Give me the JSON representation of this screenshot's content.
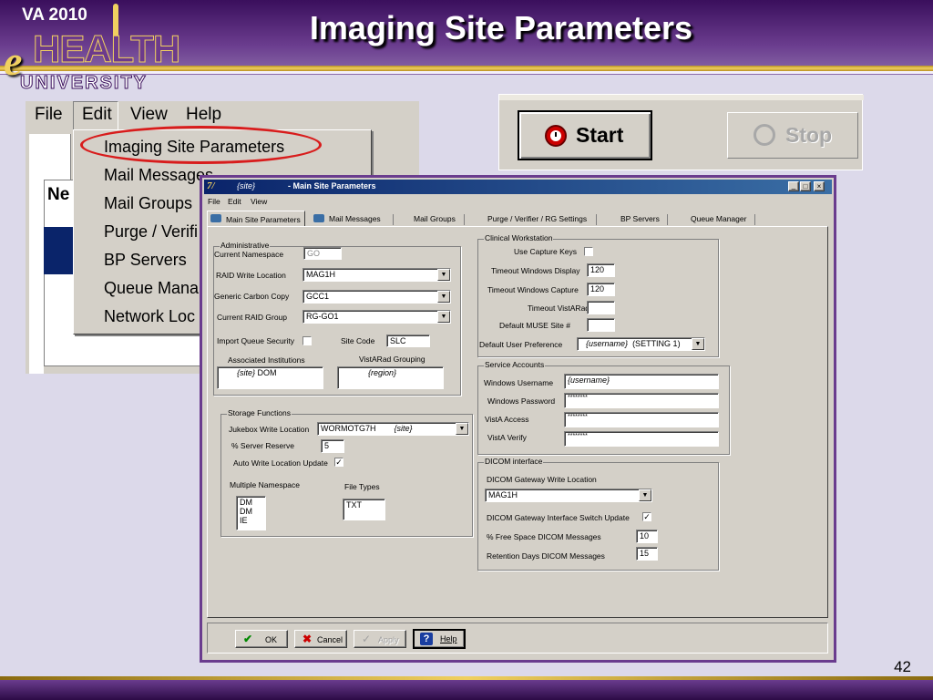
{
  "slide": {
    "title": "Imaging Site Parameters",
    "page_number": "42"
  },
  "logo": {
    "year_text": "VA 2010",
    "letter_e": "e",
    "health_text": "HEALTH",
    "university_text": "UNIVERSITY"
  },
  "menu_screenshot": {
    "menubar": [
      "File",
      "Edit",
      "View",
      "Help"
    ],
    "edit_menu_items": [
      "Imaging Site Parameters",
      "Mail Messages",
      "Mail Groups",
      "Purge / Verifi",
      "BP Servers",
      "Queue Mana",
      "Network Loc"
    ],
    "highlighted_item": "Imaging Site Parameters",
    "partial_list_text": "Ne"
  },
  "toolbar_screenshot": {
    "start_label": "Start",
    "stop_label": "Stop"
  },
  "dialog": {
    "title_site": "{site}",
    "title_text": "- Main Site Parameters",
    "menu": [
      "File",
      "Edit",
      "View"
    ],
    "tabs": [
      "Main Site Parameters",
      "Mail Messages",
      "Mail Groups",
      "Purge / Verifier / RG Settings",
      "BP Servers",
      "Queue Manager"
    ],
    "administrative": {
      "group_label": "Administrative",
      "current_namespace_label": "Current Namespace",
      "current_namespace_value": "GO",
      "raid_write_location_label": "RAID Write Location",
      "raid_write_location_value": "MAG1H",
      "generic_carbon_copy_label": "Generic Carbon Copy",
      "generic_carbon_copy_value": "GCC1",
      "current_raid_group_label": "Current  RAID Group",
      "current_raid_group_value": "RG-GO1",
      "import_queue_security_label": "Import Queue Security",
      "import_queue_security_checked": false,
      "site_code_label": "Site Code",
      "site_code_value": "SLC",
      "associated_institutions_label": "Associated Institutions",
      "associated_institutions_value_site": "{site}",
      "associated_institutions_value_code": "DOM",
      "vistarad_grouping_label": "VistARad Grouping",
      "vistarad_grouping_value": "{region}"
    },
    "storage": {
      "group_label": "Storage Functions",
      "jukebox_write_location_label": "Jukebox Write Location",
      "jukebox_write_location_value": "WORMOTG7H",
      "jukebox_write_location_site": "{site}",
      "server_reserve_label": "% Server Reserve",
      "server_reserve_value": "5",
      "auto_write_location_update_label": "Auto Write Location Update",
      "auto_write_location_update_checked": true,
      "multiple_namespace_label": "Multiple Namespace",
      "multiple_namespace_values": [
        "DM",
        "DM",
        "IE"
      ],
      "file_types_label": "File Types",
      "file_types_value": "TXT"
    },
    "clinical": {
      "group_label": "Clinical Workstation",
      "use_capture_keys_label": "Use Capture Keys",
      "use_capture_keys_checked": false,
      "timeout_windows_display_label": "Timeout Windows Display",
      "timeout_windows_display_value": "120",
      "timeout_windows_capture_label": "Timeout Windows Capture",
      "timeout_windows_capture_value": "120",
      "timeout_vistarad_label": "Timeout VistARad",
      "timeout_vistarad_value": "",
      "default_muse_site_label": "Default MUSE Site #",
      "default_muse_site_value": "",
      "default_user_preference_label": "Default User Preference",
      "default_user_preference_user": "{username}",
      "default_user_preference_setting": "(SETTING 1)"
    },
    "service": {
      "group_label": "Service Accounts",
      "windows_username_label": "Windows Username",
      "windows_username_value": "{username}",
      "windows_password_label": "Windows Password",
      "windows_password_value": "********",
      "vista_access_label": "VistA Access",
      "vista_access_value": "********",
      "vista_verify_label": "VistA Verify",
      "vista_verify_value": "********"
    },
    "dicom": {
      "group_label": "DICOM interface",
      "gateway_write_location_label": "DICOM Gateway Write Location",
      "gateway_write_location_value": "MAG1H",
      "interface_switch_update_label": "DICOM Gateway  Interface Switch Update",
      "interface_switch_update_checked": true,
      "free_space_label": "% Free Space DICOM Messages",
      "free_space_value": "10",
      "retention_days_label": "Retention Days DICOM Messages",
      "retention_days_value": "15"
    },
    "buttons": {
      "ok": "OK",
      "cancel": "Cancel",
      "apply": "Apply",
      "help": "Help"
    }
  },
  "colors": {
    "header_purple": "#3a0f5c",
    "gold": "#f0d060",
    "highlight_ring": "#d81c1c",
    "dialog_frame": "#6a3c8e",
    "titlebar": "#0a246a"
  }
}
